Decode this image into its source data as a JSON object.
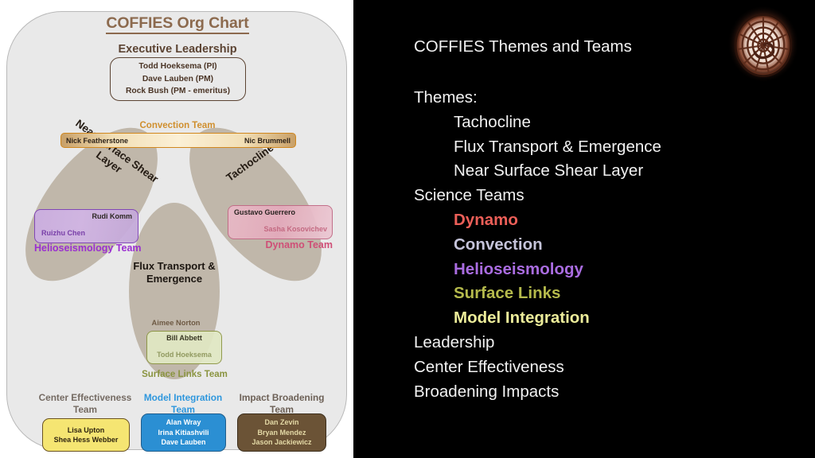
{
  "left_slide": {
    "title": "COFFIES Org Chart",
    "exec_heading": "Executive Leadership",
    "exec_members": [
      "Todd Hoeksema (PI)",
      "Dave Lauben (PM)",
      "Rock Bush (PM - emeritus)"
    ],
    "venn": {
      "nssl_label": "Near Surface Shear Layer",
      "tachocline_label": "Tachocline",
      "flux_label": "Flux Transport & Emergence",
      "petal_color": "#a79783"
    },
    "convection": {
      "heading": "Convection Team",
      "members": [
        "Nick Featherstone",
        "Nic Brummell"
      ],
      "accent": "#d0871e"
    },
    "helioseismology": {
      "team_label": "Helioseismology Team",
      "member_top": "Rudi Komm",
      "member_bottom": "Ruizhu Chen",
      "accent": "#9a2fd0"
    },
    "dynamo": {
      "team_label": "Dynamo Team",
      "member_top": "Gustavo Guerrero",
      "member_bottom": "Sasha Kosovichev",
      "accent": "#cf4f77"
    },
    "surface_links": {
      "team_label": "Surface Links Team",
      "member_above": "Aimee Norton",
      "member_top": "Bill Abbett",
      "member_bottom": "Todd Hoeksema",
      "accent": "#8a9440"
    },
    "bottom_teams": [
      {
        "heading": "Center Effectiveness Team",
        "members": [
          "Lisa Upton",
          "Shea Hess Webber"
        ],
        "box_color": "#f5e572",
        "heading_color": "#756b63"
      },
      {
        "heading": "Model Integration Team",
        "members": [
          "Alan Wray",
          "Irina Kitiashvili",
          "Dave Lauben"
        ],
        "box_color": "#2b8fd3",
        "heading_color": "#2f97dd"
      },
      {
        "heading": "Impact Broadening Team",
        "members": [
          "Dan Zevin",
          "Bryan Mendez",
          "Jason Jackiewicz"
        ],
        "box_color": "#6b5336",
        "heading_color": "#6d6157"
      }
    ]
  },
  "right_slide": {
    "title": "COFFIES Themes and Teams",
    "logo_name": "coffies-spiral-logo",
    "lines": [
      {
        "text": "Themes:",
        "indent": false,
        "bold": false,
        "color": "#f2f2f2"
      },
      {
        "text": "Tachocline",
        "indent": true,
        "bold": false,
        "color": "#f2f2f2"
      },
      {
        "text": "Flux Transport & Emergence",
        "indent": true,
        "bold": false,
        "color": "#f2f2f2"
      },
      {
        "text": "Near Surface Shear Layer",
        "indent": true,
        "bold": false,
        "color": "#f2f2f2"
      },
      {
        "text": "Science Teams",
        "indent": false,
        "bold": false,
        "color": "#f2f2f2"
      },
      {
        "text": "Dynamo",
        "indent": true,
        "bold": true,
        "color": "#ec5f58"
      },
      {
        "text": "Convection",
        "indent": true,
        "bold": true,
        "color": "#c5c4da"
      },
      {
        "text": "Helioseismology",
        "indent": true,
        "bold": true,
        "color": "#a96ce0"
      },
      {
        "text": "Surface Links",
        "indent": true,
        "bold": true,
        "color": "#b5ba4c"
      },
      {
        "text": "Model Integration",
        "indent": true,
        "bold": true,
        "color": "#eded9a"
      },
      {
        "text": "Leadership",
        "indent": false,
        "bold": false,
        "color": "#f2f2f2"
      },
      {
        "text": "Center Effectiveness",
        "indent": false,
        "bold": false,
        "color": "#f2f2f2"
      },
      {
        "text": "Broadening Impacts",
        "indent": false,
        "bold": false,
        "color": "#f2f2f2"
      }
    ]
  }
}
